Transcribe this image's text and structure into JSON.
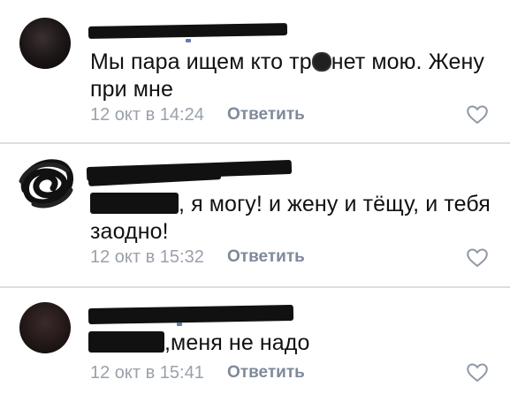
{
  "comments": [
    {
      "text_before": "Мы пара ищем кто тр",
      "text_after": "нет мою. Жену",
      "text_line2": "при мне",
      "date": "12 окт в 14:24",
      "reply_label": "Ответить",
      "like_icon": "heart-outline-icon"
    },
    {
      "text_line1": ", я могу! и жену и тёщу, и тебя",
      "text_line2": "заодно!",
      "date": "12 окт в 15:32",
      "reply_label": "Ответить",
      "like_icon": "heart-outline-icon"
    },
    {
      "text_line1": ",меня не надо",
      "date": "12 окт в 15:41",
      "reply_label": "Ответить",
      "like_icon": "heart-outline-icon"
    }
  ],
  "colors": {
    "text": "#111111",
    "meta": "#9aa1aa",
    "reply": "#7e8a9a",
    "divider": "#dedede"
  }
}
